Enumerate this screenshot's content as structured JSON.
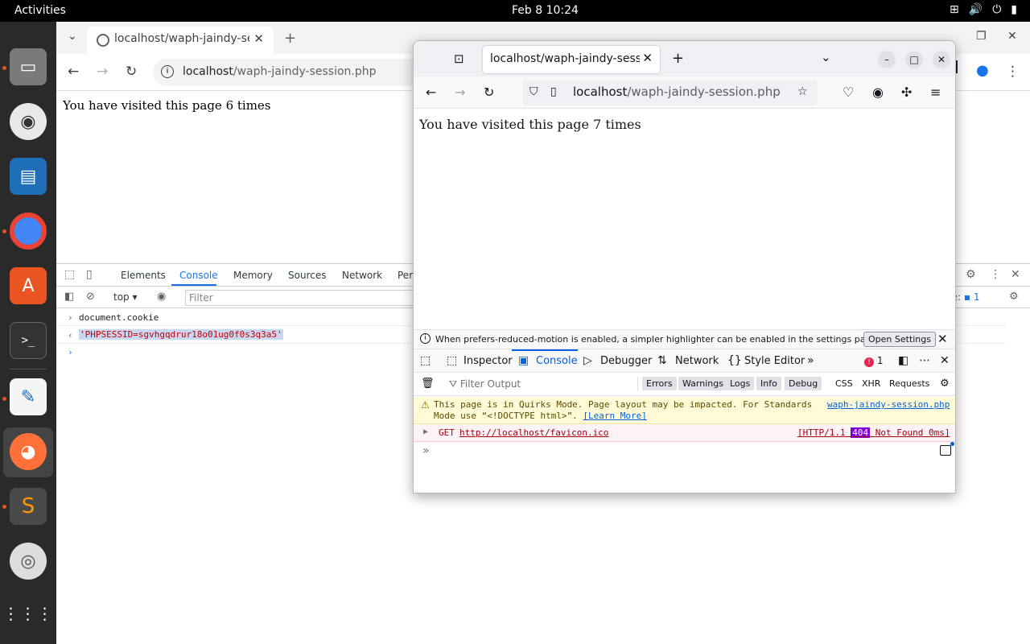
{
  "topbar": {
    "activities": "Activities",
    "clock": "Feb 8  10:24"
  },
  "dock": {
    "apps": [
      "files-icon",
      "rhythmbox-icon",
      "writer-icon",
      "chrome-icon",
      "app-center-icon",
      "terminal-icon",
      "text-editor-icon",
      "firefox-icon",
      "sublime-icon",
      "dvd-icon",
      "show-apps-icon"
    ]
  },
  "chrome": {
    "tab_title": "localhost/waph-jaindy-se",
    "url_host": "localhost",
    "url_path": "/waph-jaindy-session.php",
    "page_text": "You have visited this page 6 times",
    "devtools": {
      "tabs": [
        "Elements",
        "Console",
        "Memory",
        "Sources",
        "Network",
        "Per"
      ],
      "context": "top",
      "filter_placeholder": "Filter",
      "issues_label": "ue:",
      "issues_count": "1",
      "console": {
        "command": "document.cookie",
        "result": "'PHPSESSID=sgvhgqdrur18o01ug0f0s3q3a5'"
      }
    }
  },
  "firefox": {
    "tab_title": "localhost/waph-jaindy-sessio",
    "url_host": "localhost",
    "url_path": "/waph-jaindy-session.php",
    "page_text": "You have visited this page 7 times",
    "notice": {
      "text": "When prefers-reduced-motion is enabled, a simpler highlighter can be enabled in the settings panel, to a...",
      "button": "Open Settings"
    },
    "devtools": {
      "tabs": [
        "Inspector",
        "Console",
        "Debugger",
        "Network",
        "Style Editor"
      ],
      "error_count": "1",
      "filter_placeholder": "Filter Output",
      "levels": [
        "Errors",
        "Warnings",
        "Logs",
        "Info",
        "Debug"
      ],
      "types": [
        "CSS",
        "XHR",
        "Requests"
      ],
      "warning": {
        "line1": "This page is in Quirks Mode. Page layout may be impacted. For Standards",
        "line2_prefix": "Mode use “<!DOCTYPE html>”.",
        "learn_more": "[Learn More]",
        "source": "waph-jaindy-session.php"
      },
      "error": {
        "method": "GET",
        "url": "http://localhost/favicon.ico",
        "status_prefix": "[HTTP/1.1",
        "status_code": "404",
        "status_suffix": "Not Found 0ms]"
      },
      "prompt": "»"
    }
  }
}
